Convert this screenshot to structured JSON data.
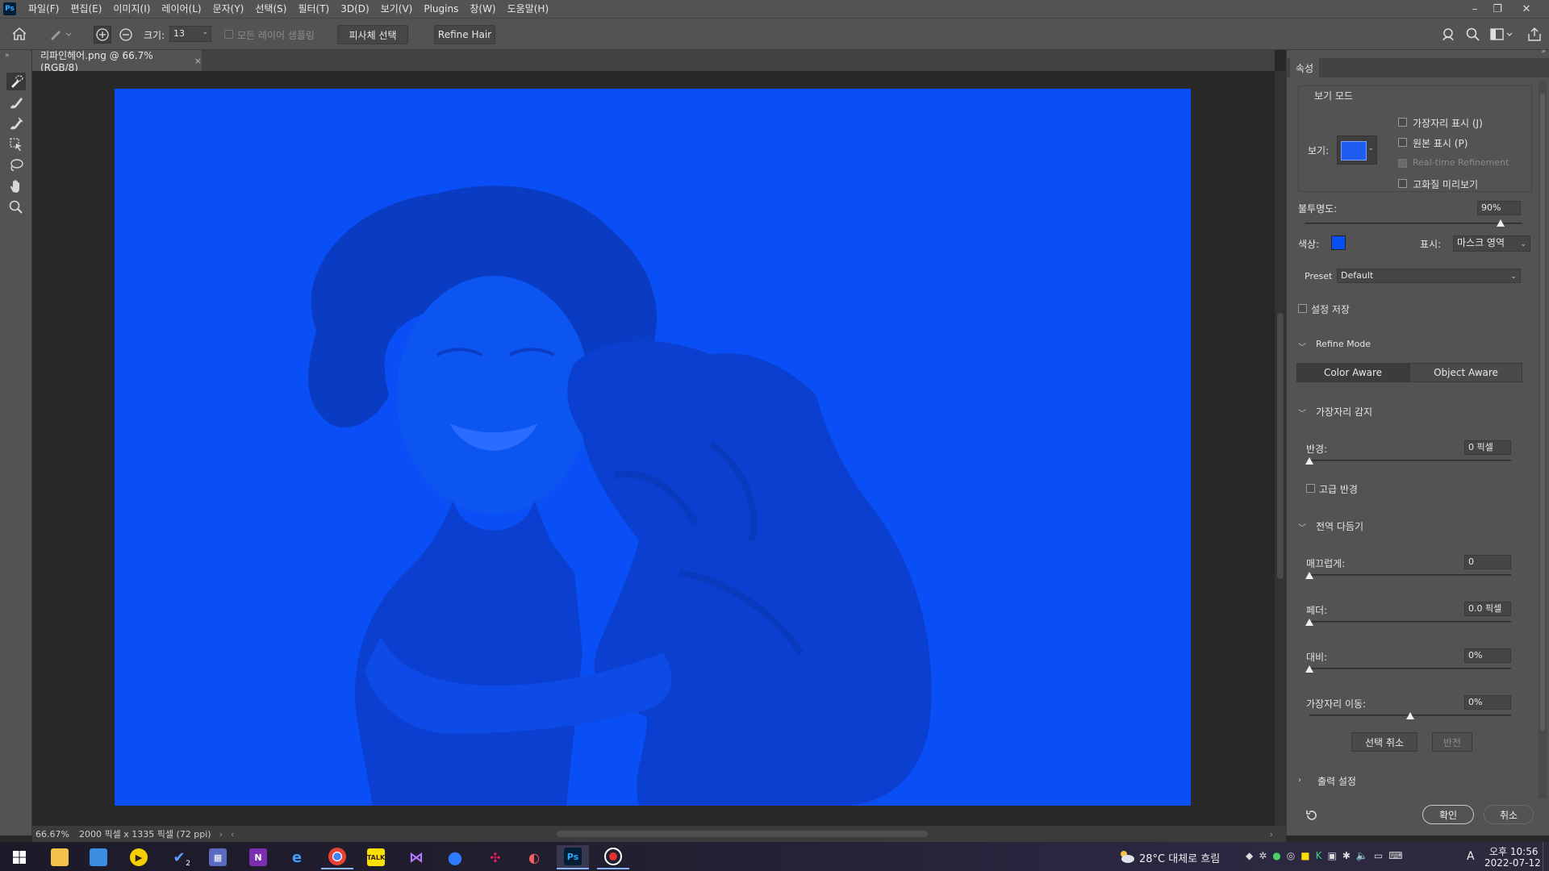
{
  "menu": {
    "app_icon": "Ps",
    "items": [
      "파일(F)",
      "편집(E)",
      "이미지(I)",
      "레이어(L)",
      "문자(Y)",
      "선택(S)",
      "필터(T)",
      "3D(D)",
      "보기(V)",
      "Plugins",
      "창(W)",
      "도움말(H)"
    ]
  },
  "options": {
    "size_label": "크기:",
    "size_value": "13",
    "sample_all_layers": "모든 레이어 샘플링",
    "select_subject": "피사체 선택",
    "refine_hair": "Refine Hair"
  },
  "document": {
    "tab_title": "리파인헤어.png @ 66.7% (RGB/8)",
    "zoom": "66.67%",
    "doc_info": "2000 픽셀 x 1335 픽셀 (72 ppi)"
  },
  "panel": {
    "tab": "속성",
    "view_mode": {
      "title": "보기 모드",
      "view_label": "보기:",
      "show_edge": "가장자리 표시 (J)",
      "show_original": "원본 표시 (P)",
      "realtime": "Real-time Refinement",
      "high_quality": "고화질 미리보기"
    },
    "opacity_label": "불투명도:",
    "opacity_value": "90%",
    "opacity_fraction": 0.9,
    "color_label": "색상:",
    "mask_color": "#0a4ff5",
    "display_label": "표시:",
    "display_value": "마스크 영역",
    "preset_label": "Preset",
    "preset_value": "Default",
    "save_settings": "설정 저장",
    "refine_mode": {
      "title": "Refine Mode",
      "color_aware": "Color Aware",
      "object_aware": "Object Aware"
    },
    "edge_detection": {
      "title": "가장자리 감지",
      "radius_label": "반경:",
      "radius_value": "0 픽셀",
      "smart_radius": "고급 반경"
    },
    "global_refinements": {
      "title": "전역 다듬기",
      "smooth_label": "매끄럽게:",
      "smooth_value": "0",
      "feather_label": "페더:",
      "feather_value": "0.0 픽셀",
      "contrast_label": "대비:",
      "contrast_value": "0%",
      "shift_edge_label": "가장자리 이동:",
      "shift_edge_value": "0%",
      "shift_edge_fraction": 0.5
    },
    "clear_selection": "선택 취소",
    "invert": "반전",
    "output": {
      "title": "출력 설정"
    },
    "ok": "확인",
    "cancel": "취소"
  },
  "taskbar": {
    "weather": "28°C  대체로 흐림",
    "time": "오후 10:56",
    "date": "2022-07-12",
    "ime": "A",
    "badge_count": "2"
  },
  "colors": {
    "accent_blue": "#0a4ff5",
    "ui_gray": "#535353"
  }
}
